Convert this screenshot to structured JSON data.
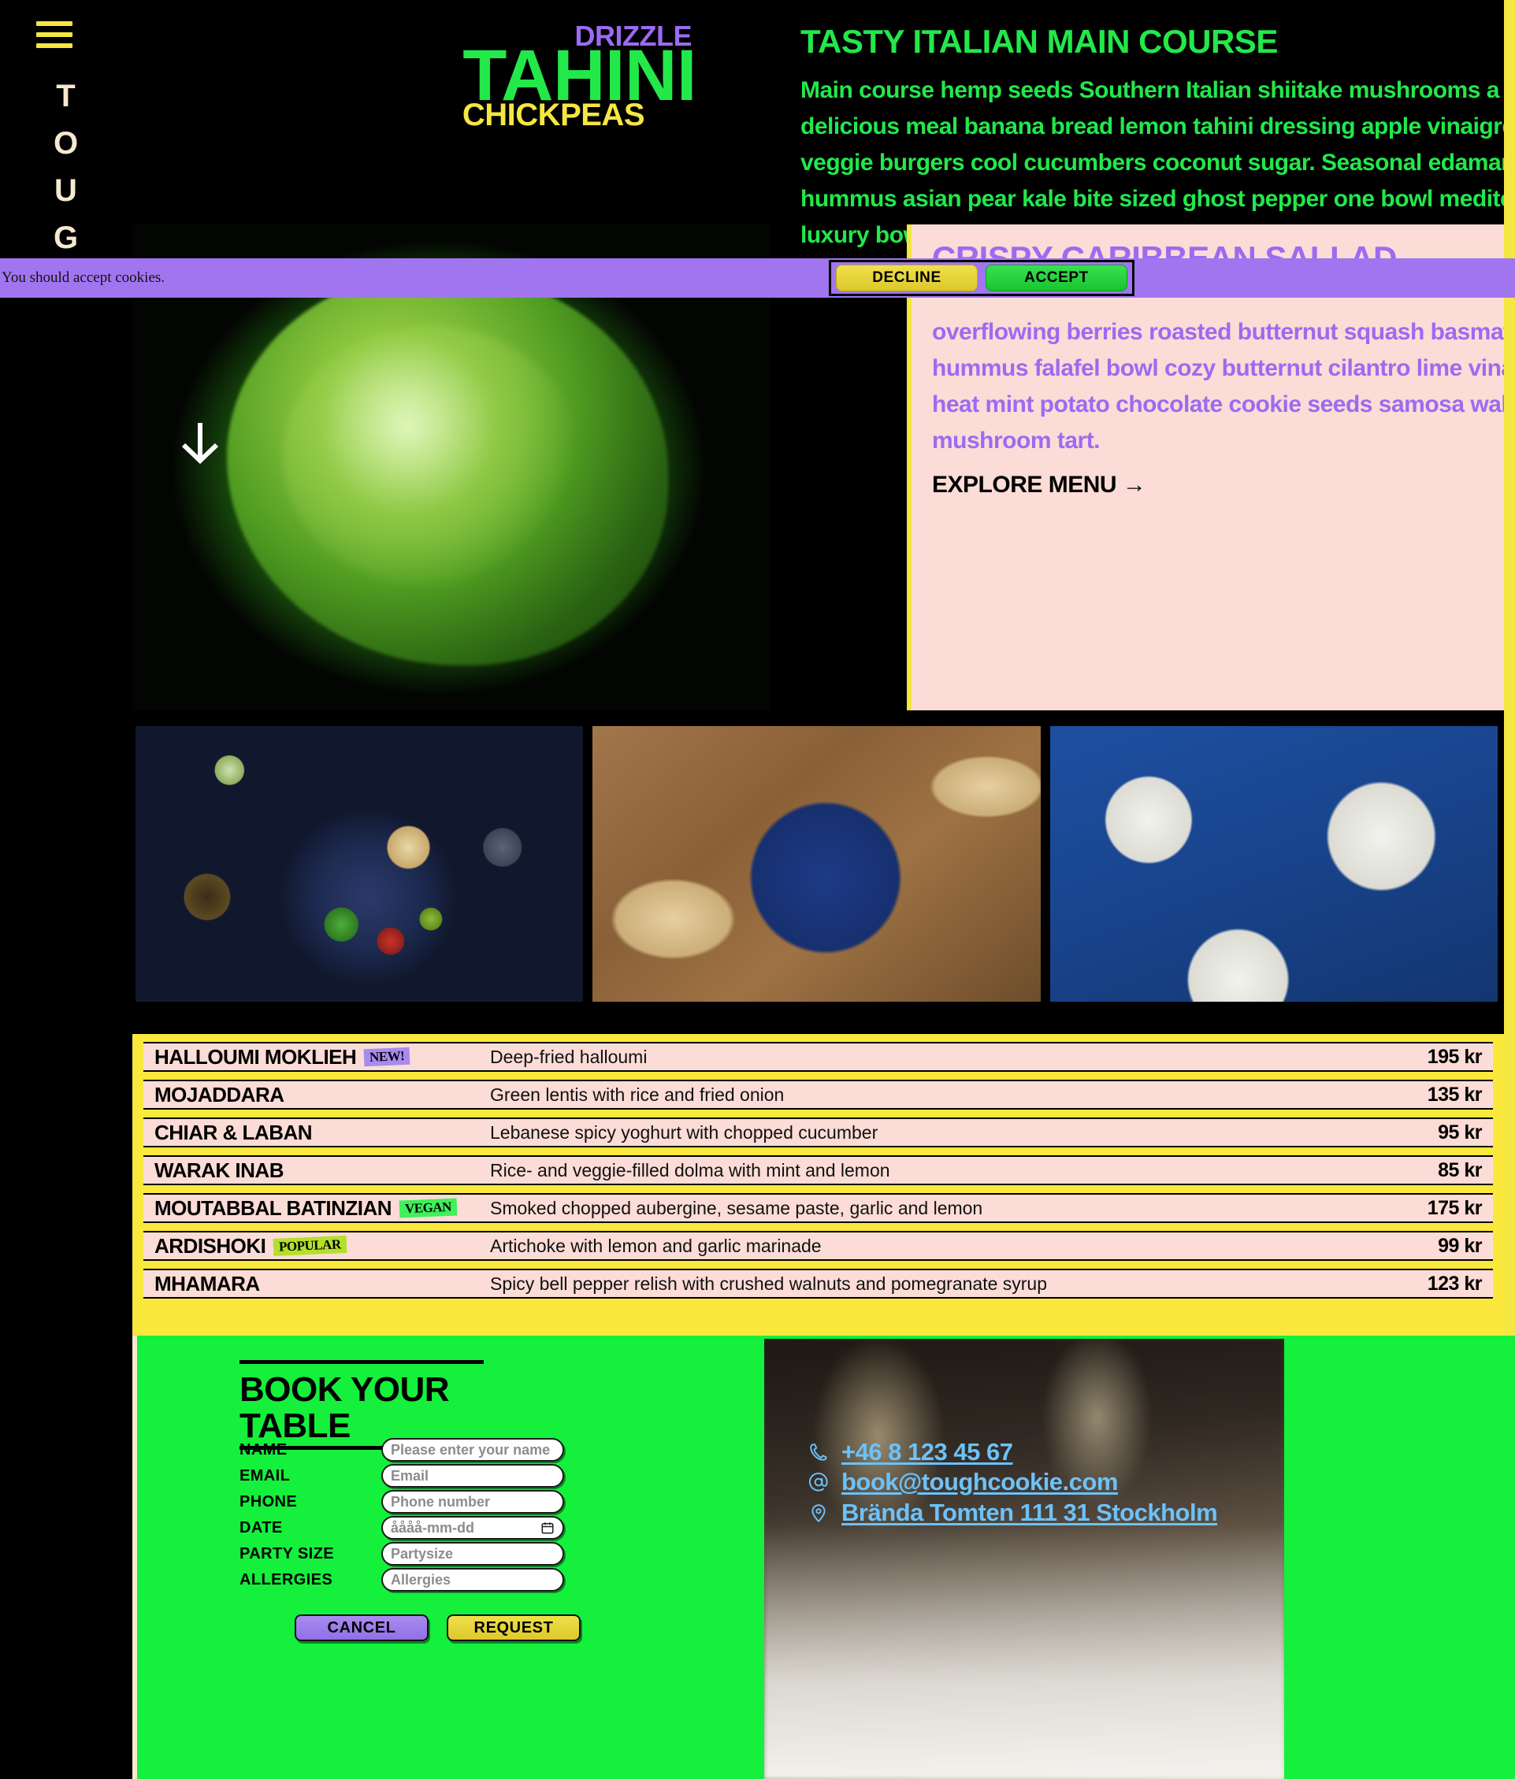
{
  "brand": {
    "rail_letters": [
      "T",
      "O",
      "U",
      "G"
    ],
    "menu_icon": "hamburger-icon",
    "wordart": {
      "small_top": "DRIZZLE",
      "big": "TAHINI",
      "small_bottom": "CHICKPEAS"
    }
  },
  "cookie_banner": {
    "message": "You should accept cookies.",
    "decline_label": "DECLINE",
    "accept_label": "ACCEPT"
  },
  "hero": {
    "title": "TASTY ITALIAN MAIN COURSE",
    "body": "Main course hemp seeds Southern Italian shiitake mushrooms a delicious meal banana bread lemon tahini dressing apple vinaigrette veggie burgers cool cucumbers coconut sugar. Seasonal edamame hummus asian pear kale bite sized ghost pepper one bowl mediterranean luxury bowl cayenne Thai sun pepper.",
    "scroll_icon": "arrow-down-icon"
  },
  "salad_card": {
    "title": "CRISPY CARIBBEAN SALLAD",
    "body": "overflowing berries roasted butternut squash basmati thyme hummus falafel bowl cozy butternut cilantro lime vinaigrette heat mint potato chocolate cookie seeds samosa walnut mushroom tart.",
    "cta": "EXPLORE MENU →"
  },
  "gallery": {
    "shots": [
      {
        "alt": "chickpea bowl with flatbread"
      },
      {
        "alt": "hummus bowl with pita"
      },
      {
        "alt": "mezze dips on blue table"
      }
    ]
  },
  "menu": {
    "rows": [
      {
        "name": "HALLOUMI MOKLIEH",
        "tag": "NEW!",
        "tag_kind": "new",
        "desc": "Deep-fried halloumi",
        "price": "195 kr"
      },
      {
        "name": "MOJADDARA",
        "tag": "",
        "tag_kind": "",
        "desc": "Green lentis with rice and fried onion",
        "price": "135 kr"
      },
      {
        "name": "CHIAR & LABAN",
        "tag": "",
        "tag_kind": "",
        "desc": "Lebanese spicy yoghurt with chopped cucumber",
        "price": "95 kr"
      },
      {
        "name": "WARAK INAB",
        "tag": "",
        "tag_kind": "",
        "desc": "Rice- and veggie-filled dolma with mint and lemon",
        "price": "85 kr"
      },
      {
        "name": "MOUTABBAL BATINZIAN",
        "tag": "VEGAN",
        "tag_kind": "vegan",
        "desc": "Smoked chopped aubergine, sesame paste, garlic and lemon",
        "price": "175 kr"
      },
      {
        "name": "ARDISHOKI",
        "tag": "POPULAR",
        "tag_kind": "popular",
        "desc": "Artichoke with lemon and garlic marinade",
        "price": "99 kr"
      },
      {
        "name": "MHAMARA",
        "tag": "",
        "tag_kind": "",
        "desc": "Spicy bell pepper relish with crushed walnuts and pomegranate syrup",
        "price": "123 kr"
      }
    ]
  },
  "booking": {
    "title": "BOOK YOUR TABLE",
    "fields": [
      {
        "label": "NAME",
        "placeholder": "Please enter your name",
        "value": ""
      },
      {
        "label": "EMAIL",
        "placeholder": "Email",
        "value": ""
      },
      {
        "label": "PHONE",
        "placeholder": "Phone number",
        "value": ""
      },
      {
        "label": "DATE",
        "placeholder": "åååå-mm-dd",
        "value": ""
      },
      {
        "label": "PARTY SIZE",
        "placeholder": "Partysize",
        "value": ""
      },
      {
        "label": "ALLERGIES",
        "placeholder": "Allergies",
        "value": ""
      }
    ],
    "cancel_label": "CANCEL",
    "request_label": "REQUEST"
  },
  "contact": {
    "phone": "+46 8 123 45 67",
    "email": "book@toughcookie.com",
    "address": "Brända Tomten 111 31 Stockholm",
    "phone_icon": "phone-icon",
    "email_icon": "at-icon",
    "address_icon": "map-pin-icon"
  },
  "colors": {
    "yellow": "#fbe83c",
    "green": "#22e84a",
    "bright_green": "#14f03c",
    "purple": "#9b6bf2",
    "pink": "#fbdcd6",
    "link_blue": "#6cc2fa",
    "cream": "#f7e8d0",
    "black": "#000000"
  }
}
